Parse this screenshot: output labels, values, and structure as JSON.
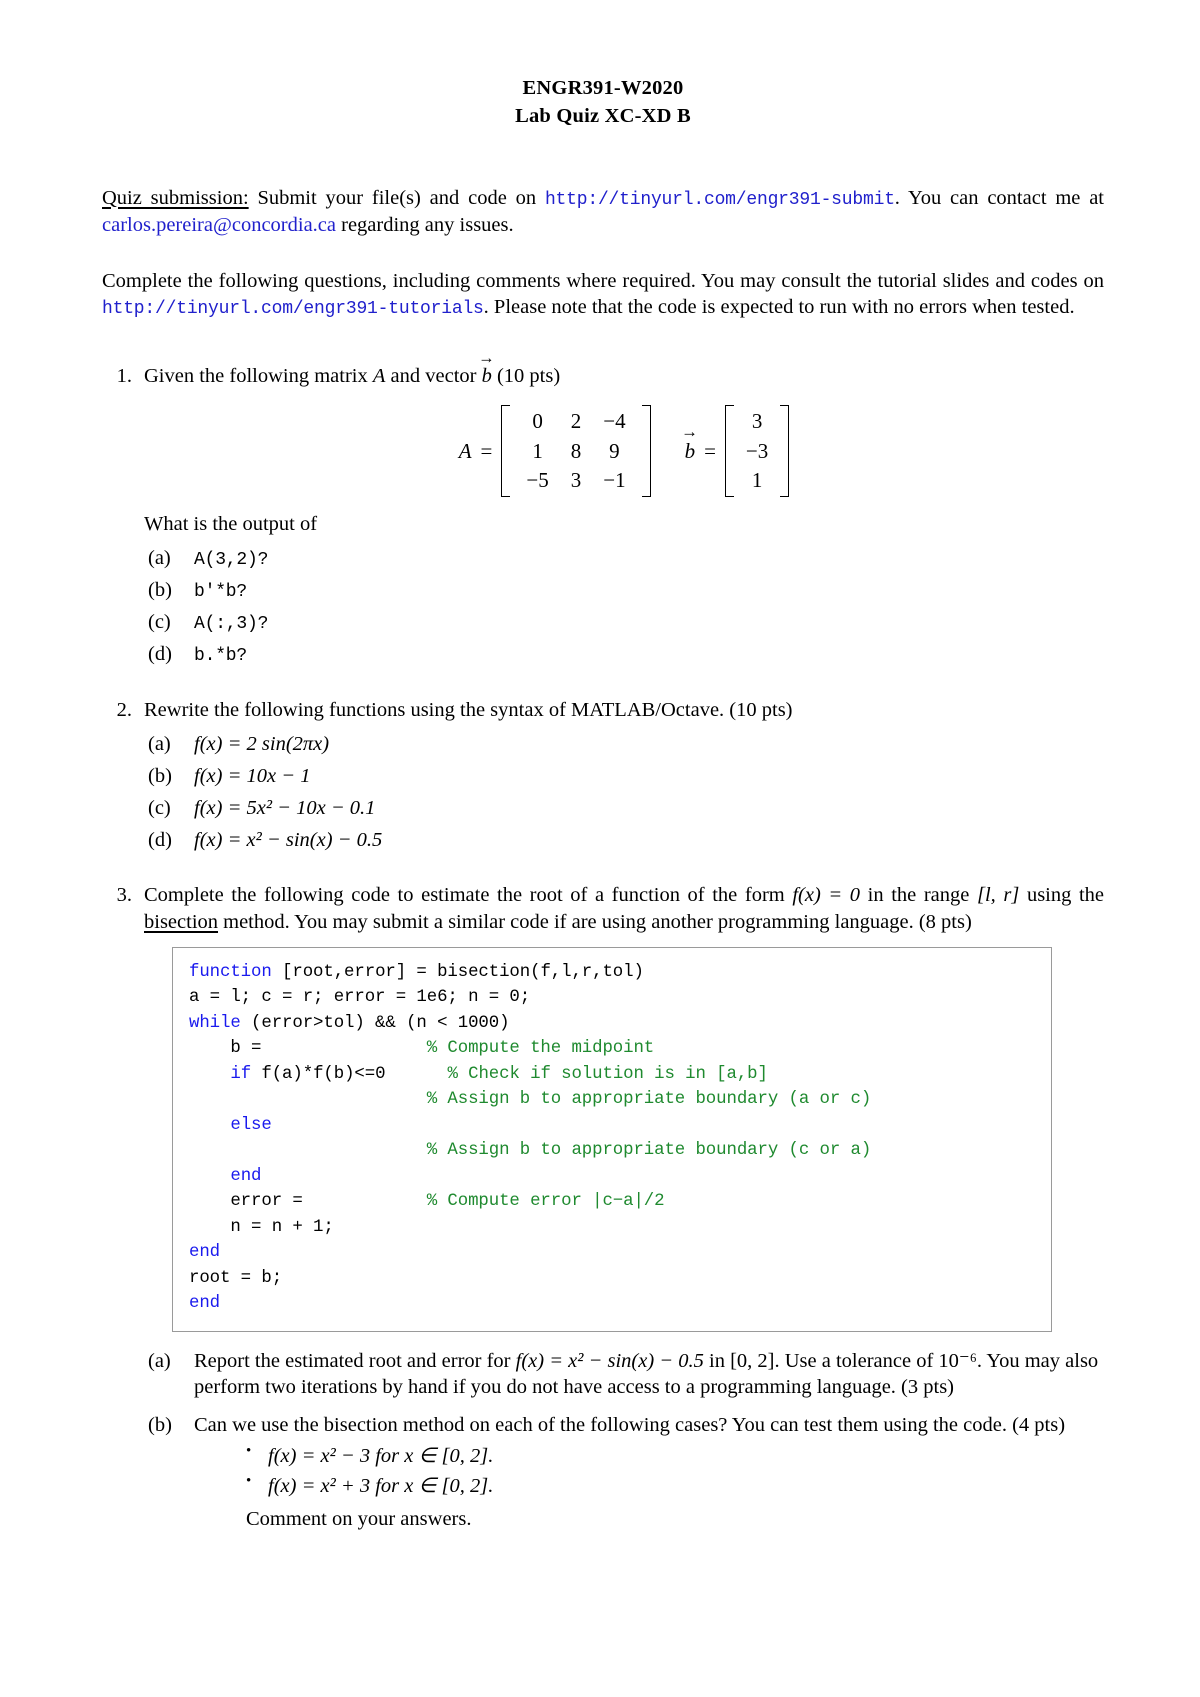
{
  "header": {
    "course_line": "ENGR391-W2020",
    "quiz_line": "Lab Quiz XC-XD B"
  },
  "intro": {
    "submission_label": "Quiz submission:",
    "submission_text_1": " Submit your file(s) and code on ",
    "submit_url": "http://tinyurl.com/engr391-submit",
    "submission_text_2": ". You can contact me at ",
    "email": "carlos.pereira@concordia.ca",
    "submission_text_3": " regarding any issues.",
    "instructions_1": "Complete the following questions, including comments where required. You may consult the tutorial slides and codes on ",
    "tutorials_url": "http://tinyurl.com/engr391-tutorials",
    "instructions_2": ". Please note that the code is expected to run with no errors when tested."
  },
  "questions": [
    {
      "number": "1.",
      "text_before_A": "Given the following matrix ",
      "var_A": "A",
      "text_middle": " and vector ",
      "var_b": "b",
      "points": " (10 pts)",
      "matrix_A_label": "A",
      "matrix_A": [
        [
          "0",
          "2",
          "−4"
        ],
        [
          "1",
          "8",
          "9"
        ],
        [
          "−5",
          "3",
          "−1"
        ]
      ],
      "vector_b_label": "b",
      "vector_b": [
        [
          "3"
        ],
        [
          "−3"
        ],
        [
          "1"
        ]
      ],
      "prompt": "What is the output of",
      "items": [
        {
          "letter": "(a)",
          "code": "A(3,2)?"
        },
        {
          "letter": "(b)",
          "code": "b'*b?"
        },
        {
          "letter": "(c)",
          "code": "A(:,3)?"
        },
        {
          "letter": "(d)",
          "code": "b.*b?"
        }
      ]
    },
    {
      "number": "2.",
      "text": "Rewrite the following functions using the syntax of MATLAB/Octave. (10 pts)",
      "items": [
        {
          "letter": "(a)",
          "formula": "f(x) = 2 sin(2πx)"
        },
        {
          "letter": "(b)",
          "formula": "f(x) = 10x − 1"
        },
        {
          "letter": "(c)",
          "formula": "f(x) = 5x² − 10x − 0.1"
        },
        {
          "letter": "(d)",
          "formula": "f(x) = x² − sin(x) − 0.5"
        }
      ]
    },
    {
      "number": "3.",
      "text_1": "Complete the following code to estimate the root of a function of the form ",
      "eq_1": "f(x) = 0",
      "text_2": " in the range ",
      "range": "[l, r]",
      "text_3": " using the ",
      "underlined": "bisection",
      "text_4": " method. You may submit a similar code if are using another programming language. (8 pts)",
      "code_lines": [
        {
          "kw": "function",
          "rest": " [root,error] = bisection(f,l,r,tol)"
        },
        {
          "plain": "a = l; c = r; error = 1e6; n = 0;"
        },
        {
          "kw": "while",
          "rest": " (error>tol) && (n < 1000)"
        },
        {
          "plain": "    b =                ",
          "cm": "% Compute the midpoint"
        },
        {
          "indent": "    ",
          "kw": "if",
          "rest": " f(a)*f(b)<=0      ",
          "cm": "% Check if solution is in [a,b]"
        },
        {
          "plain": "                       ",
          "cm": "% Assign b to appropriate boundary (a or c)"
        },
        {
          "indent": "    ",
          "kw": "else"
        },
        {
          "plain": "                       ",
          "cm": "% Assign b to appropriate boundary (c or a)"
        },
        {
          "indent": "    ",
          "kw": "end"
        },
        {
          "plain": "    error =            ",
          "cm": "% Compute error |c−a|/2"
        },
        {
          "plain": "    n = n + 1;"
        },
        {
          "kw": "end"
        },
        {
          "plain": "root = b;"
        },
        {
          "kw": "end"
        }
      ],
      "items": [
        {
          "letter": "(a)",
          "text_1": "Report the estimated root and error for ",
          "eq": "f(x) = x² − sin(x) − 0.5",
          "text_2": " in [0, 2]. Use a tolerance of ",
          "tol": "10⁻⁶",
          "text_3": ". You may also perform two iterations by hand if you do not have access to a programming language. (3 pts)"
        },
        {
          "letter": "(b)",
          "text": "Can we use the bisection method on each of the following cases? You can test them using the code. (4 pts)",
          "bullets": [
            "f(x) = x² − 3 for x ∈ [0, 2].",
            "f(x) = x² + 3 for x ∈ [0, 2]."
          ],
          "closing": "Comment on your answers."
        }
      ]
    }
  ],
  "colors": {
    "link": "#2020cc",
    "keyword": "#1a1aee",
    "comment": "#1f8a2f",
    "code_border": "#9a9a9a"
  }
}
